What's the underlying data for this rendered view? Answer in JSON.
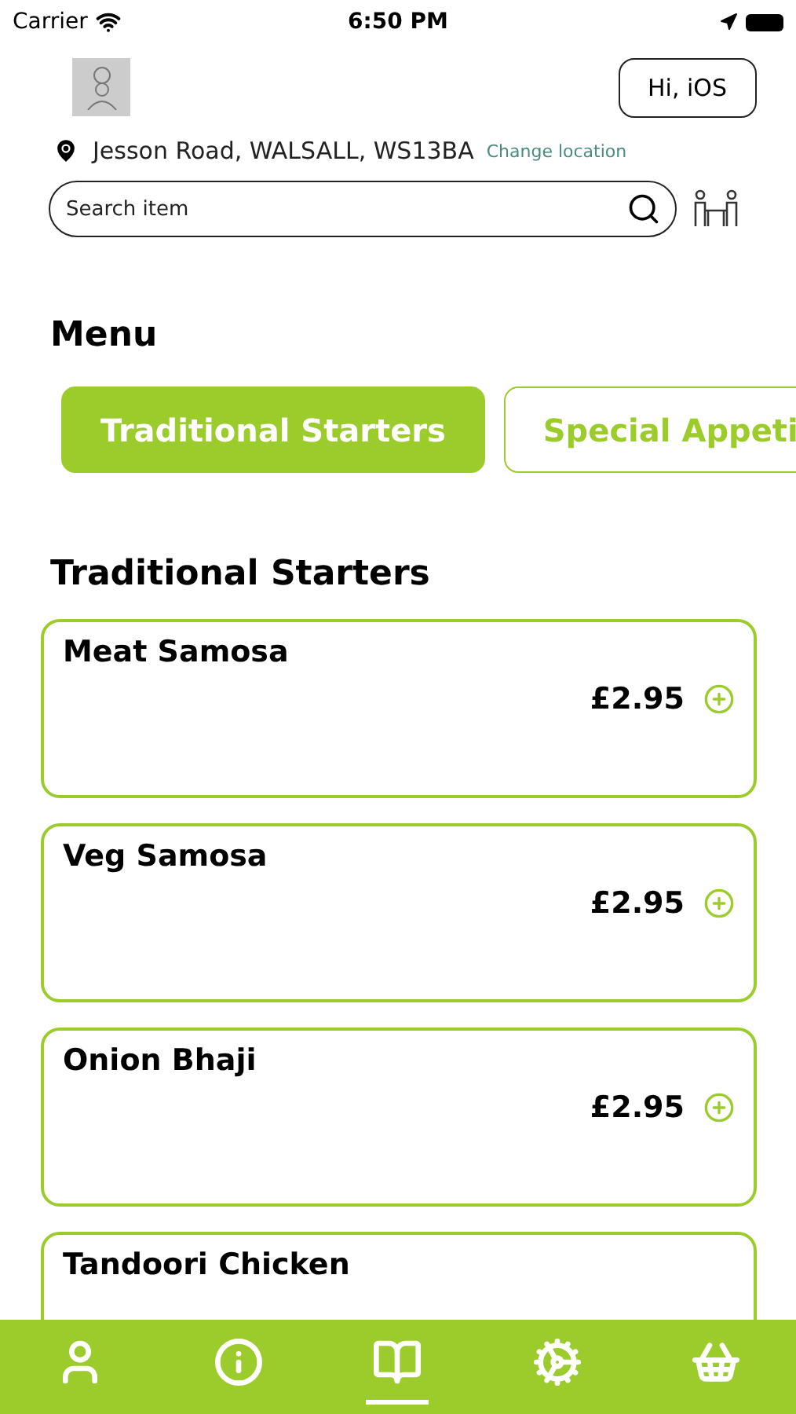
{
  "status_bar": {
    "carrier": "Carrier",
    "time": "6:50 PM"
  },
  "header": {
    "greeting": "Hi, iOS"
  },
  "location": {
    "address": "Jesson Road, WALSALL, WS13BA",
    "action": "Change location"
  },
  "search": {
    "placeholder": "Search item"
  },
  "menu_title": "Menu",
  "categories": [
    {
      "label": "Traditional Starters",
      "selected": true
    },
    {
      "label": "Special Appeti",
      "selected": false
    }
  ],
  "section_title": "Traditional Starters",
  "items": [
    {
      "name": "Meat Samosa",
      "price": "£2.95"
    },
    {
      "name": "Veg Samosa",
      "price": "£2.95"
    },
    {
      "name": "Onion Bhaji",
      "price": "£2.95"
    },
    {
      "name": "Tandoori Chicken"
    }
  ],
  "nav": [
    {
      "kind": "user",
      "selected": false
    },
    {
      "kind": "info",
      "selected": false
    },
    {
      "kind": "menu",
      "selected": true
    },
    {
      "kind": "gear",
      "selected": false
    },
    {
      "kind": "basket",
      "selected": false
    }
  ]
}
